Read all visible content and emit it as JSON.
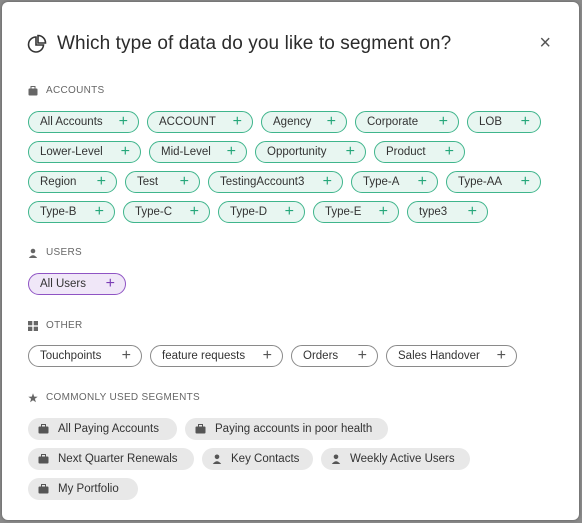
{
  "header": {
    "title": "Which type of data do you like to segment on?",
    "close_label": "×"
  },
  "sections": {
    "accounts": {
      "label": "ACCOUNTS",
      "rows": [
        [
          {
            "label": "All Accounts",
            "w": 111
          },
          {
            "label": "ACCOUNT",
            "w": 106
          },
          {
            "label": "Agency",
            "w": 86
          },
          {
            "label": "Corporate",
            "w": 104
          },
          {
            "label": "LOB",
            "w": 74
          }
        ],
        [
          {
            "label": "Lower-Level",
            "w": 113
          },
          {
            "label": "Mid-Level",
            "w": 98
          },
          {
            "label": "Opportunity",
            "w": 111
          },
          {
            "label": "Product",
            "w": 91
          }
        ],
        [
          {
            "label": "Region",
            "w": 89
          },
          {
            "label": "Test",
            "w": 75
          },
          {
            "label": "TestingAccount3",
            "w": 135
          },
          {
            "label": "Type-A",
            "w": 87
          },
          {
            "label": "Type-AA",
            "w": 95
          }
        ],
        [
          {
            "label": "Type-B",
            "w": 87
          },
          {
            "label": "Type-C",
            "w": 87
          },
          {
            "label": "Type-D",
            "w": 87
          },
          {
            "label": "Type-E",
            "w": 86
          },
          {
            "label": "type3",
            "w": 81
          }
        ]
      ]
    },
    "users": {
      "label": "USERS",
      "rows": [
        [
          {
            "label": "All Users",
            "w": 98
          }
        ]
      ]
    },
    "other": {
      "label": "OTHER",
      "rows": [
        [
          {
            "label": "Touchpoints",
            "w": 114
          },
          {
            "label": "feature requests",
            "w": 133
          },
          {
            "label": "Orders",
            "w": 87
          },
          {
            "label": "Sales Handover",
            "w": 131
          }
        ]
      ]
    },
    "common": {
      "label": "COMMONLY USED SEGMENTS",
      "rows": [
        [
          {
            "label": "All Paying Accounts",
            "icon": "briefcase-icon",
            "w": 149
          },
          {
            "label": "Paying accounts in poor health",
            "icon": "briefcase-icon",
            "w": 203
          }
        ],
        [
          {
            "label": "Next Quarter Renewals",
            "icon": "briefcase-icon",
            "w": 166
          },
          {
            "label": "Key Contacts",
            "icon": "user-icon",
            "w": 111
          },
          {
            "label": "Weekly Active Users",
            "icon": "user-icon",
            "w": 149
          }
        ],
        [
          {
            "label": "My Portfolio",
            "icon": "briefcase-icon",
            "w": 110
          }
        ]
      ]
    }
  },
  "colors": {
    "account_chip_border": "#3fb58c",
    "user_chip_border": "#8f54c4",
    "other_chip_border": "#8a8a8a",
    "common_chip_bg": "#e8e8e8"
  }
}
